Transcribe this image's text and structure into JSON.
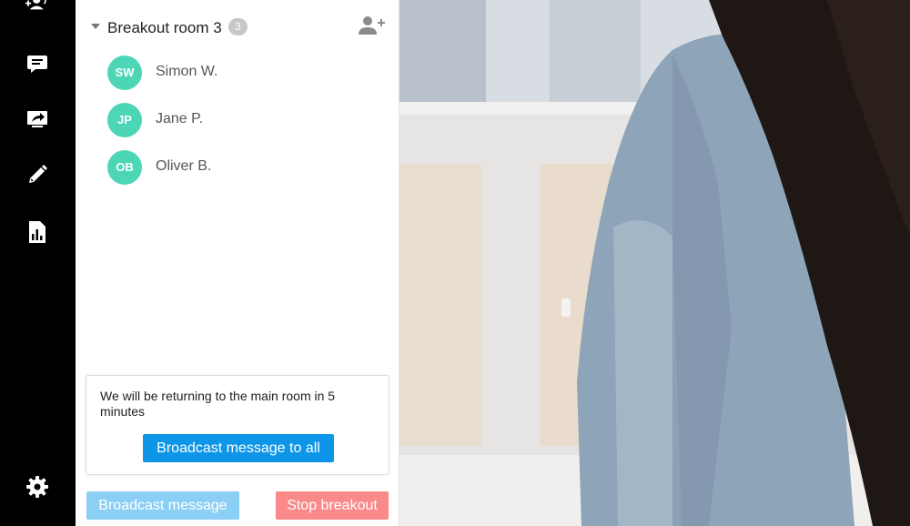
{
  "rail": {
    "icons": [
      "participants-voice-icon",
      "chat-icon",
      "screen-share-icon",
      "pencil-icon",
      "report-icon",
      "settings-gear-icon"
    ]
  },
  "room": {
    "title": "Breakout room 3",
    "count": "3",
    "participants": [
      {
        "initials": "SW",
        "name": "Simon W."
      },
      {
        "initials": "JP",
        "name": "Jane P."
      },
      {
        "initials": "OB",
        "name": "Oliver B."
      }
    ]
  },
  "notice": {
    "message": "We will be returning to the main room in 5 minutes",
    "broadcast_all_label": "Broadcast message to all"
  },
  "footer": {
    "broadcast_label": "Broadcast message",
    "stop_label": "Stop breakout"
  },
  "colors": {
    "avatar": "#4dd6b5",
    "primary_button": "#0d96e8",
    "secondary_button": "#8ccff5",
    "danger_button": "#fa8a8a"
  }
}
